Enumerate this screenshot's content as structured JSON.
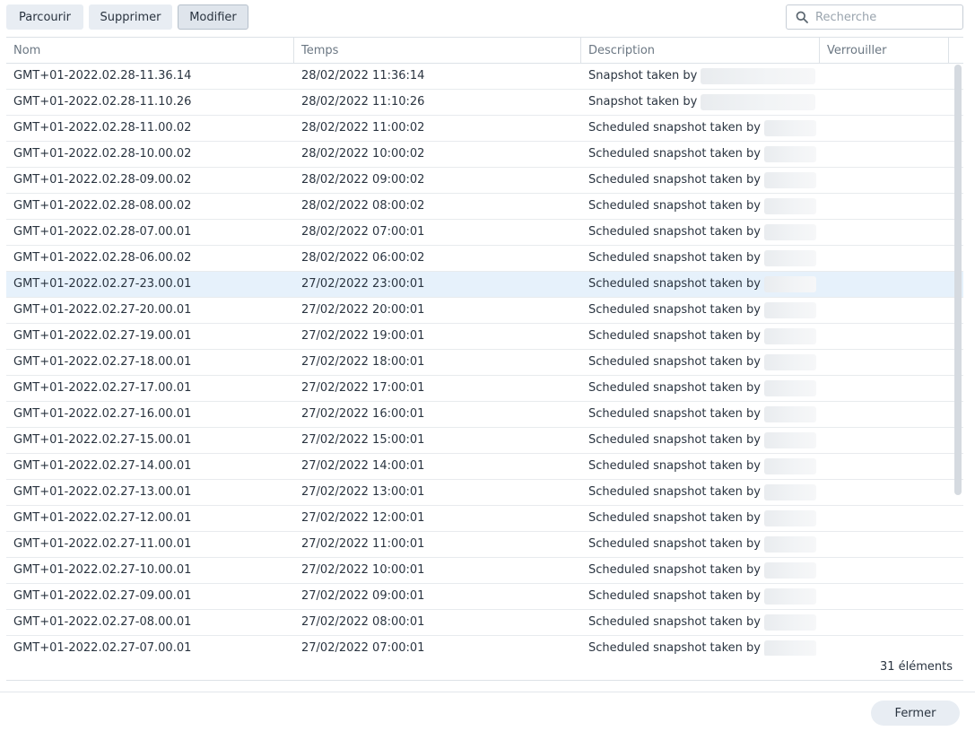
{
  "toolbar": {
    "browse_label": "Parcourir",
    "delete_label": "Supprimer",
    "edit_label": "Modifier"
  },
  "search": {
    "placeholder": "Recherche",
    "icon": "search-icon"
  },
  "table": {
    "columns": [
      "Nom",
      "Temps",
      "Description",
      "Verrouiller"
    ],
    "rows": [
      {
        "name": "GMT+01-2022.02.28-11.36.14",
        "time": "28/02/2022 11:36:14",
        "description": "Snapshot taken by"
      },
      {
        "name": "GMT+01-2022.02.28-11.10.26",
        "time": "28/02/2022 11:10:26",
        "description": "Snapshot taken by"
      },
      {
        "name": "GMT+01-2022.02.28-11.00.02",
        "time": "28/02/2022 11:00:02",
        "description": "Scheduled snapshot taken by"
      },
      {
        "name": "GMT+01-2022.02.28-10.00.02",
        "time": "28/02/2022 10:00:02",
        "description": "Scheduled snapshot taken by"
      },
      {
        "name": "GMT+01-2022.02.28-09.00.02",
        "time": "28/02/2022 09:00:02",
        "description": "Scheduled snapshot taken by"
      },
      {
        "name": "GMT+01-2022.02.28-08.00.02",
        "time": "28/02/2022 08:00:02",
        "description": "Scheduled snapshot taken by"
      },
      {
        "name": "GMT+01-2022.02.28-07.00.01",
        "time": "28/02/2022 07:00:01",
        "description": "Scheduled snapshot taken by"
      },
      {
        "name": "GMT+01-2022.02.28-06.00.02",
        "time": "28/02/2022 06:00:02",
        "description": "Scheduled snapshot taken by"
      },
      {
        "name": "GMT+01-2022.02.27-23.00.01",
        "time": "27/02/2022 23:00:01",
        "description": "Scheduled snapshot taken by",
        "selected": true
      },
      {
        "name": "GMT+01-2022.02.27-20.00.01",
        "time": "27/02/2022 20:00:01",
        "description": "Scheduled snapshot taken by"
      },
      {
        "name": "GMT+01-2022.02.27-19.00.01",
        "time": "27/02/2022 19:00:01",
        "description": "Scheduled snapshot taken by"
      },
      {
        "name": "GMT+01-2022.02.27-18.00.01",
        "time": "27/02/2022 18:00:01",
        "description": "Scheduled snapshot taken by"
      },
      {
        "name": "GMT+01-2022.02.27-17.00.01",
        "time": "27/02/2022 17:00:01",
        "description": "Scheduled snapshot taken by"
      },
      {
        "name": "GMT+01-2022.02.27-16.00.01",
        "time": "27/02/2022 16:00:01",
        "description": "Scheduled snapshot taken by"
      },
      {
        "name": "GMT+01-2022.02.27-15.00.01",
        "time": "27/02/2022 15:00:01",
        "description": "Scheduled snapshot taken by"
      },
      {
        "name": "GMT+01-2022.02.27-14.00.01",
        "time": "27/02/2022 14:00:01",
        "description": "Scheduled snapshot taken by"
      },
      {
        "name": "GMT+01-2022.02.27-13.00.01",
        "time": "27/02/2022 13:00:01",
        "description": "Scheduled snapshot taken by"
      },
      {
        "name": "GMT+01-2022.02.27-12.00.01",
        "time": "27/02/2022 12:00:01",
        "description": "Scheduled snapshot taken by"
      },
      {
        "name": "GMT+01-2022.02.27-11.00.01",
        "time": "27/02/2022 11:00:01",
        "description": "Scheduled snapshot taken by"
      },
      {
        "name": "GMT+01-2022.02.27-10.00.01",
        "time": "27/02/2022 10:00:01",
        "description": "Scheduled snapshot taken by"
      },
      {
        "name": "GMT+01-2022.02.27-09.00.01",
        "time": "27/02/2022 09:00:01",
        "description": "Scheduled snapshot taken by"
      },
      {
        "name": "GMT+01-2022.02.27-08.00.01",
        "time": "27/02/2022 08:00:01",
        "description": "Scheduled snapshot taken by"
      },
      {
        "name": "GMT+01-2022.02.27-07.00.01",
        "time": "27/02/2022 07:00:01",
        "description": "Scheduled snapshot taken by"
      }
    ]
  },
  "footer": {
    "count_label": "31 éléments"
  },
  "dialog": {
    "close_label": "Fermer"
  },
  "colors": {
    "selected_row": "#e6f1fb",
    "button_bg": "#e8edf3",
    "border": "#dde2e7"
  }
}
